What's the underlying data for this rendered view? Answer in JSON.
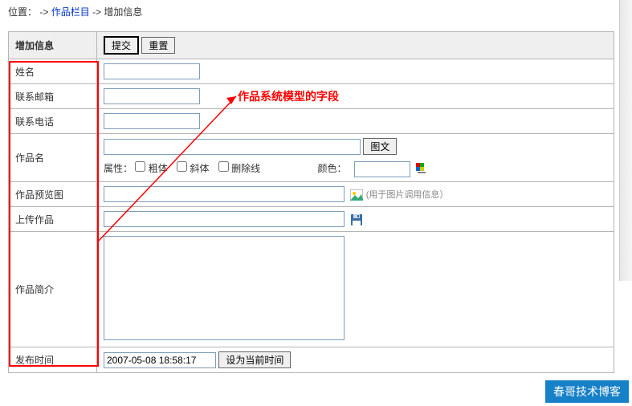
{
  "breadcrumb": {
    "label": "位置：",
    "sep": " -> ",
    "link1": "作品栏目",
    "current": "增加信息"
  },
  "header": {
    "title": "增加信息",
    "submit": "提交",
    "reset": "重置"
  },
  "fields": {
    "name_label": "姓名",
    "email_label": "联系邮箱",
    "phone_label": "联系电话",
    "work_name_label": "作品名",
    "graphic_btn": "图文",
    "attr_label": "属性：",
    "bold_label": "粗体",
    "italic_label": "斜体",
    "strike_label": "删除线",
    "color_label": "颜色：",
    "preview_label": "作品预览图",
    "preview_hint": "(用于图片调用信息）",
    "upload_label": "上传作品",
    "intro_label": "作品简介",
    "publish_label": "发布时间",
    "publish_value": "2007-05-08 18:58:17",
    "set_now_btn": "设为当前时间"
  },
  "annotation": {
    "text": "作品系统模型的字段"
  },
  "watermark": {
    "text": "春哥技术博客"
  }
}
